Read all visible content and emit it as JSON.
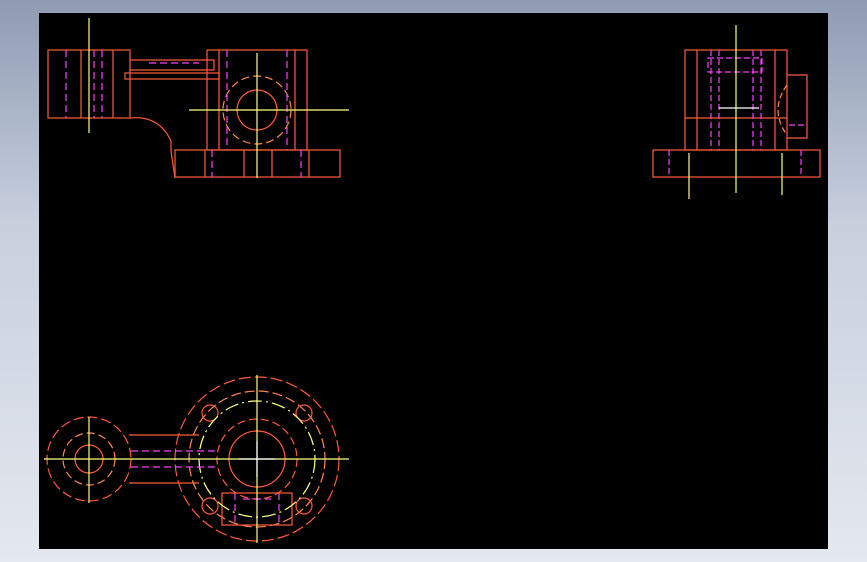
{
  "drawing": {
    "background": "#000000",
    "frame_color_top": "#8e9bb3",
    "frame_color_bottom": "#e4e8ef",
    "line_colors": {
      "outline": "#ff5a3c",
      "hidden": "#ff3cff",
      "center": "#ffff80",
      "detail": "#ff8a50",
      "white": "#ffffff"
    },
    "views": [
      "front-view",
      "side-view",
      "top-view"
    ]
  }
}
